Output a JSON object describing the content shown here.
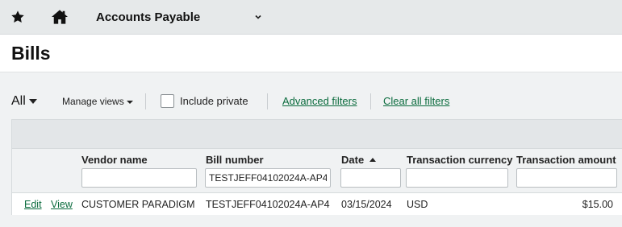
{
  "topbar": {
    "favorites_icon": "star-icon",
    "home_icon": "home-icon",
    "app_name": "Accounts Payable",
    "app_menu_icon": "chevron-down-icon"
  },
  "page": {
    "title": "Bills"
  },
  "filters": {
    "view_label": "All",
    "manage_views_label": "Manage views",
    "include_private_label": "Include private",
    "include_private_checked": false,
    "advanced_filters_label": "Advanced filters",
    "clear_filters_label": "Clear all filters"
  },
  "table": {
    "columns": [
      {
        "label": "Vendor name",
        "filter_value": ""
      },
      {
        "label": "Bill number",
        "filter_value": "TESTJEFF04102024A-AP4"
      },
      {
        "label": "Date",
        "filter_value": "",
        "sort": "ascending"
      },
      {
        "label": "Transaction currency",
        "filter_value": ""
      },
      {
        "label": "Transaction amount",
        "filter_value": ""
      }
    ],
    "rows": [
      {
        "edit_label": "Edit",
        "view_label": "View",
        "vendor": "CUSTOMER PARADIGM",
        "bill_number": "TESTJEFF04102024A-AP4",
        "date": "03/15/2024",
        "currency": "USD",
        "amount": "$15.00"
      }
    ]
  },
  "colors": {
    "link": "#0a6b3d",
    "header_bg": "#e3e6e8"
  }
}
